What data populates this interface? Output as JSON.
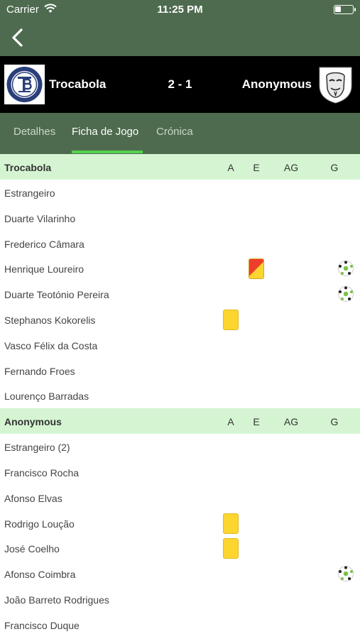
{
  "status_bar": {
    "carrier": "Carrier",
    "time": "11:25 PM"
  },
  "match": {
    "home_team": "Trocabola",
    "away_team": "Anonymous",
    "score": "2 - 1"
  },
  "tabs": [
    {
      "label": "Detalhes",
      "active": false
    },
    {
      "label": "Ficha de Jogo",
      "active": true
    },
    {
      "label": "Crónica",
      "active": false
    }
  ],
  "columns": {
    "a": "A",
    "e": "E",
    "ag": "AG",
    "g": "G"
  },
  "teams": [
    {
      "name": "Trocabola",
      "players": [
        {
          "name": "Estrangeiro"
        },
        {
          "name": "Duarte Vilarinho"
        },
        {
          "name": "Frederico Câmara"
        },
        {
          "name": "Henrique Loureiro",
          "red_card": true,
          "goal": true
        },
        {
          "name": "Duarte Teotónio Pereira",
          "goal": true
        },
        {
          "name": "Stephanos Kokorelis",
          "yellow_card": true
        },
        {
          "name": "Vasco Félix da Costa"
        },
        {
          "name": "Fernando Froes"
        },
        {
          "name": "Lourenço Barradas"
        }
      ]
    },
    {
      "name": "Anonymous",
      "players": [
        {
          "name": "Estrangeiro (2)"
        },
        {
          "name": "Francisco Rocha"
        },
        {
          "name": "Afonso Elvas"
        },
        {
          "name": "Rodrigo Loução",
          "yellow_card": true
        },
        {
          "name": "José Coelho",
          "yellow_card": true
        },
        {
          "name": "Afonso Coimbra",
          "goal": true
        },
        {
          "name": "João Barreto Rodrigues"
        },
        {
          "name": "Francisco Duque"
        }
      ]
    }
  ],
  "colors": {
    "header_green": "#4e6b4f",
    "accent_green": "#54d24f",
    "section_bg": "#d5f5d2",
    "yellow_card": "#fdd52f",
    "red_card": "#ef3d2c"
  },
  "icons": {
    "back": "chevron-left-icon",
    "wifi": "wifi-icon",
    "battery": "battery-icon",
    "goal": "soccer-ball-icon"
  }
}
